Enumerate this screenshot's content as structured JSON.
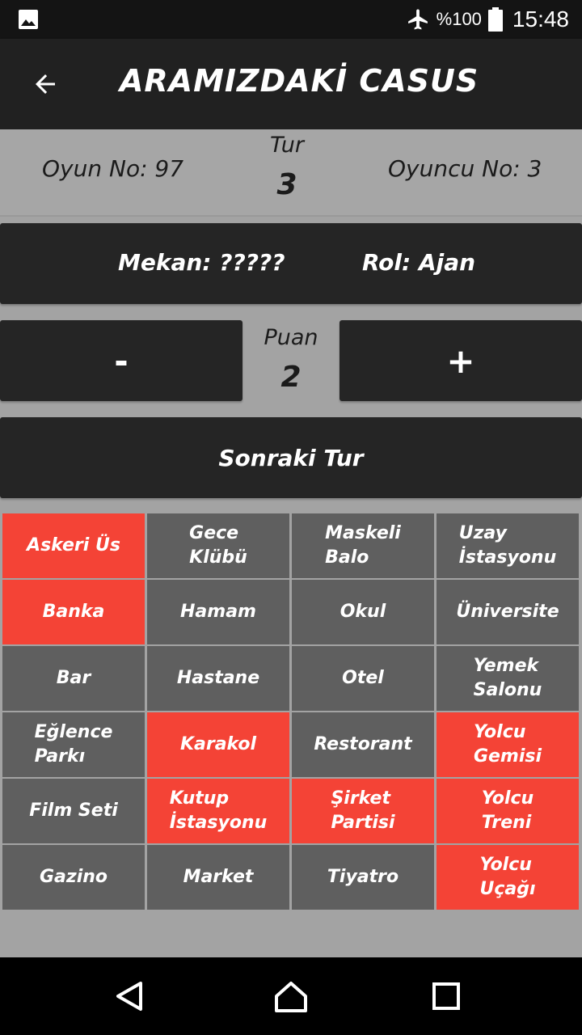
{
  "status_bar": {
    "battery": "%100",
    "time": "15:48",
    "icons": [
      "image-icon",
      "airplane-mode-icon",
      "battery-icon"
    ]
  },
  "app_bar": {
    "title": "ARAMIZDAKİ CASUS",
    "back_icon": "arrow-back-icon"
  },
  "game_info": {
    "game_no": "Oyun No: 97",
    "round_label": "Tur",
    "round_value": "3",
    "player_no": "Oyuncu No: 3"
  },
  "role_card": {
    "location": "Mekan: ?????",
    "role": "Rol: Ajan"
  },
  "score": {
    "minus_label": "-",
    "label": "Puan",
    "value": "2",
    "plus_label": "+"
  },
  "next_round_label": "Sonraki Tur",
  "colors": {
    "selected": "#f44336",
    "unselected": "#5f5f5f",
    "dark_panel": "#252525",
    "background": "#a3a3a3"
  },
  "locations": [
    {
      "label": "Askeri Üs",
      "selected": true
    },
    {
      "label": "Gece\nKlübü",
      "selected": false
    },
    {
      "label": "Maskeli\nBalo",
      "selected": false
    },
    {
      "label": "Uzay\nİstasyonu",
      "selected": false
    },
    {
      "label": "Banka",
      "selected": true
    },
    {
      "label": "Hamam",
      "selected": false
    },
    {
      "label": "Okul",
      "selected": false
    },
    {
      "label": "Üniversite",
      "selected": false
    },
    {
      "label": "Bar",
      "selected": false
    },
    {
      "label": "Hastane",
      "selected": false
    },
    {
      "label": "Otel",
      "selected": false
    },
    {
      "label": "Yemek\nSalonu",
      "selected": false
    },
    {
      "label": "Eğlence\nParkı",
      "selected": false
    },
    {
      "label": "Karakol",
      "selected": true
    },
    {
      "label": "Restorant",
      "selected": false
    },
    {
      "label": "Yolcu\nGemisi",
      "selected": true
    },
    {
      "label": "Film Seti",
      "selected": false
    },
    {
      "label": "Kutup\nİstasyonu",
      "selected": true
    },
    {
      "label": "Şirket\nPartisi",
      "selected": true
    },
    {
      "label": "Yolcu\nTreni",
      "selected": true
    },
    {
      "label": "Gazino",
      "selected": false
    },
    {
      "label": "Market",
      "selected": false
    },
    {
      "label": "Tiyatro",
      "selected": false
    },
    {
      "label": "Yolcu\nUçağı",
      "selected": true
    }
  ],
  "nav_bar": {
    "back_icon": "nav-back-icon",
    "home_icon": "nav-home-icon",
    "recents_icon": "nav-recents-icon"
  }
}
